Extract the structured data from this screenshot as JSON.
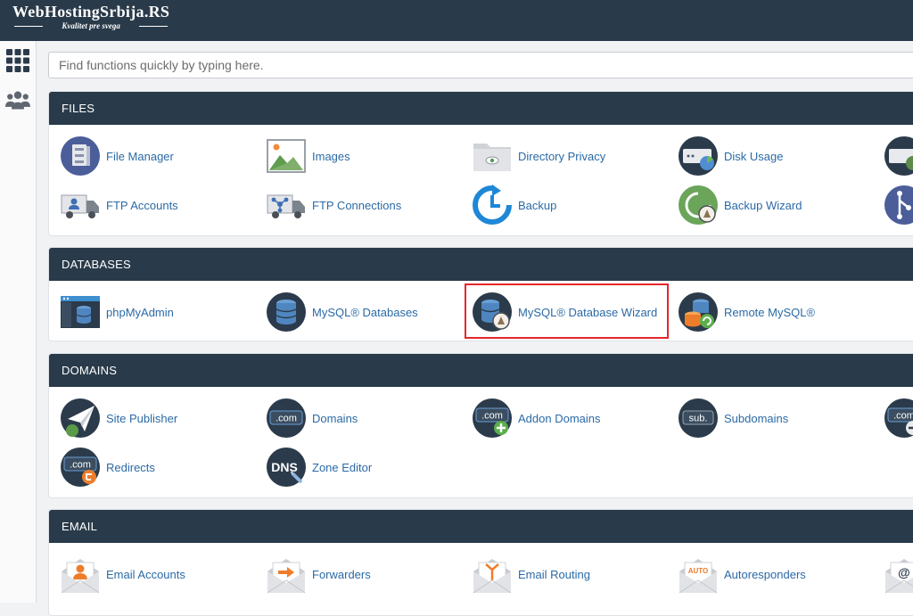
{
  "brand": {
    "title": "WebHostingSrbija.RS",
    "tagline": "Kvalitet pre svega"
  },
  "sidebar": {
    "items": [
      {
        "icon": "grid-icon"
      },
      {
        "icon": "users-icon"
      }
    ]
  },
  "search": {
    "placeholder": "Find functions quickly by typing here."
  },
  "colors": {
    "header": "#293a4a",
    "link": "#2b6aa6",
    "highlight": "#e3272b"
  },
  "sections": {
    "files": {
      "title": "FILES",
      "items": [
        {
          "label": "File Manager",
          "icon": "file-manager-icon"
        },
        {
          "label": "Images",
          "icon": "images-icon"
        },
        {
          "label": "Directory Privacy",
          "icon": "directory-privacy-icon"
        },
        {
          "label": "Disk Usage",
          "icon": "disk-usage-icon"
        },
        {
          "label": "",
          "icon": "web-disk-icon"
        },
        {
          "label": "FTP Accounts",
          "icon": "ftp-accounts-icon"
        },
        {
          "label": "FTP Connections",
          "icon": "ftp-connections-icon"
        },
        {
          "label": "Backup",
          "icon": "backup-icon"
        },
        {
          "label": "Backup Wizard",
          "icon": "backup-wizard-icon"
        },
        {
          "label": "",
          "icon": "git-icon"
        }
      ]
    },
    "databases": {
      "title": "DATABASES",
      "items": [
        {
          "label": "phpMyAdmin",
          "icon": "phpmyadmin-icon"
        },
        {
          "label": "MySQL® Databases",
          "icon": "mysql-databases-icon"
        },
        {
          "label": "MySQL® Database Wizard",
          "icon": "mysql-wizard-icon"
        },
        {
          "label": "Remote MySQL®",
          "icon": "remote-mysql-icon"
        }
      ]
    },
    "domains": {
      "title": "DOMAINS",
      "items": [
        {
          "label": "Site Publisher",
          "icon": "site-publisher-icon"
        },
        {
          "label": "Domains",
          "icon": "domains-icon"
        },
        {
          "label": "Addon Domains",
          "icon": "addon-domains-icon"
        },
        {
          "label": "Subdomains",
          "icon": "subdomains-icon"
        },
        {
          "label": "",
          "icon": "aliases-icon"
        },
        {
          "label": "Redirects",
          "icon": "redirects-icon"
        },
        {
          "label": "Zone Editor",
          "icon": "zone-editor-icon"
        }
      ]
    },
    "email": {
      "title": "EMAIL",
      "items": [
        {
          "label": "Email Accounts",
          "icon": "email-accounts-icon"
        },
        {
          "label": "Forwarders",
          "icon": "forwarders-icon"
        },
        {
          "label": "Email Routing",
          "icon": "email-routing-icon"
        },
        {
          "label": "Autoresponders",
          "icon": "autoresponders-icon"
        },
        {
          "label": "",
          "icon": "default-address-icon"
        }
      ]
    }
  }
}
